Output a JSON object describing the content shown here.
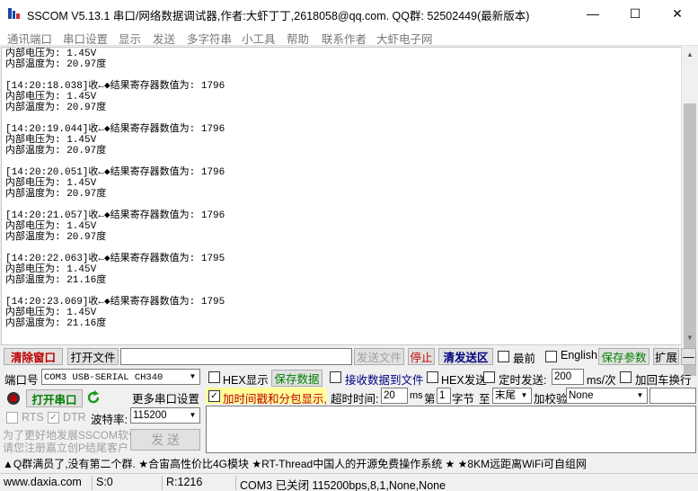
{
  "window": {
    "title": "SSCOM V5.13.1 串口/网络数据调试器,作者:大虾丁丁,2618058@qq.com. QQ群: 52502449(最新版本)",
    "minimize": "—",
    "maximize": "☐",
    "close": "✕"
  },
  "menu": [
    "通讯端口",
    "串口设置",
    "显示",
    "发送",
    "多字符串",
    "小工具",
    "帮助",
    "联系作者",
    "大虾电子网"
  ],
  "receive": {
    "lines": [
      "内部电压为: 1.45V",
      "内部温度为: 20.97度",
      "",
      "[14:20:18.038]收←◆结果寄存器数值为: 1796",
      "内部电压为: 1.45V",
      "内部温度为: 20.97度",
      "",
      "[14:20:19.044]收←◆结果寄存器数值为: 1796",
      "内部电压为: 1.45V",
      "内部温度为: 20.97度",
      "",
      "[14:20:20.051]收←◆结果寄存器数值为: 1796",
      "内部电压为: 1.45V",
      "内部温度为: 20.97度",
      "",
      "[14:20:21.057]收←◆结果寄存器数值为: 1796",
      "内部电压为: 1.45V",
      "内部温度为: 20.97度",
      "",
      "[14:20:22.063]收←◆结果寄存器数值为: 1795",
      "内部电压为: 1.45V",
      "内部温度为: 21.16度",
      "",
      "[14:20:23.069]收←◆结果寄存器数值为: 1795",
      "内部电压为: 1.45V",
      "内部温度为: 21.16度"
    ]
  },
  "toolbar": {
    "clear": "清除窗口",
    "open_file": "打开文件",
    "send_file": "发送文件",
    "stop": "停止",
    "send_area": "清发送区",
    "topmost": "最前",
    "english": "English",
    "save_params": "保存参数",
    "expand": "扩展",
    "collapse": "—"
  },
  "port": {
    "label": "端口号",
    "value": "COM3 USB-SERIAL CH340",
    "open_button": "打开串口",
    "more_settings": "更多串口设置",
    "rts": "RTS",
    "dtr": "DTR",
    "baud_label": "波特率:",
    "baud_value": "115200"
  },
  "options": {
    "hex_display": "HEX显示",
    "save_data": "保存数据",
    "recv_to_file": "接收数据到文件",
    "hex_send": "HEX发送",
    "timed_send": "定时发送:",
    "interval_value": "200",
    "interval_unit": "ms/次",
    "add_crlf": "加回车换行",
    "timestamp": "加时间戳和分包显示,",
    "timeout_label": "超时时间:",
    "timeout_value": "20",
    "timeout_unit": "ms",
    "nth_label": "第",
    "nth_value": "1",
    "byte_label": "字节",
    "to_label": "至",
    "to_value": "末尾",
    "checksum_label": "加校验",
    "checksum_value": "None"
  },
  "promo": {
    "line1": "为了更好地发展SSCOM软件",
    "line2": "请您注册嘉立创P结尾客户",
    "send_button": "发 送"
  },
  "ticker": "▲Q群满员了,没有第二个群. ★合宙高性价比4G模块 ★RT-Thread中国人的开源免费操作系统 ★ ★8KM远距离WiFi可自组网",
  "status": {
    "site": "www.daxia.com",
    "s_count": "S:0",
    "r_count": "R:1216",
    "port_state": "COM3 已关闭  115200bps,8,1,None,None"
  },
  "colors": {
    "red_text": "#c00000",
    "green_text": "#008000",
    "highlight_yellow": "#ffff99"
  }
}
